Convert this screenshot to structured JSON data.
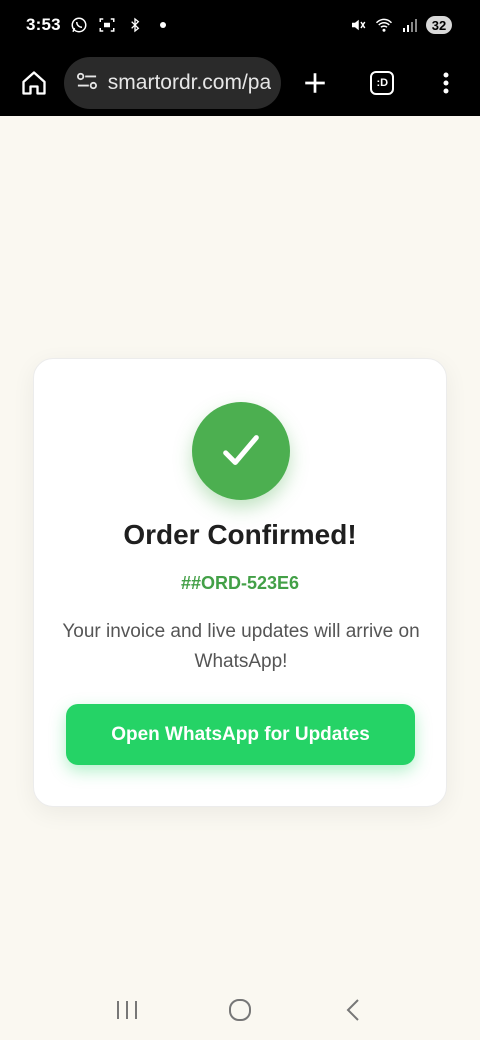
{
  "status_bar": {
    "time": "3:53",
    "battery": "32",
    "icons": [
      "whatsapp-icon",
      "screen-record-icon",
      "bluetooth-icon",
      "dot-icon",
      "mute-icon",
      "wifi-icon",
      "signal-icon",
      "battery-icon"
    ]
  },
  "browser": {
    "url": "smartordr.com/pa",
    "tab_label": ":D",
    "icons": [
      "home-icon",
      "site-settings-icon",
      "plus-icon",
      "tabs-icon",
      "more-vert-icon"
    ]
  },
  "card": {
    "title": "Order Confirmed!",
    "order_id": "##ORD-523E6",
    "message": "Your invoice and live updates will arrive on WhatsApp!",
    "button_label": "Open WhatsApp for Updates",
    "check_icon": "checkmark-icon"
  },
  "nav_bar": {
    "icons": [
      "recents-icon",
      "home-circle-icon",
      "back-icon"
    ]
  },
  "colors": {
    "success_green": "#4caf50",
    "order_id_green": "#43a047",
    "whatsapp_green": "#25d366",
    "page_bg": "#faf8f1",
    "bar_bg": "#000000"
  }
}
